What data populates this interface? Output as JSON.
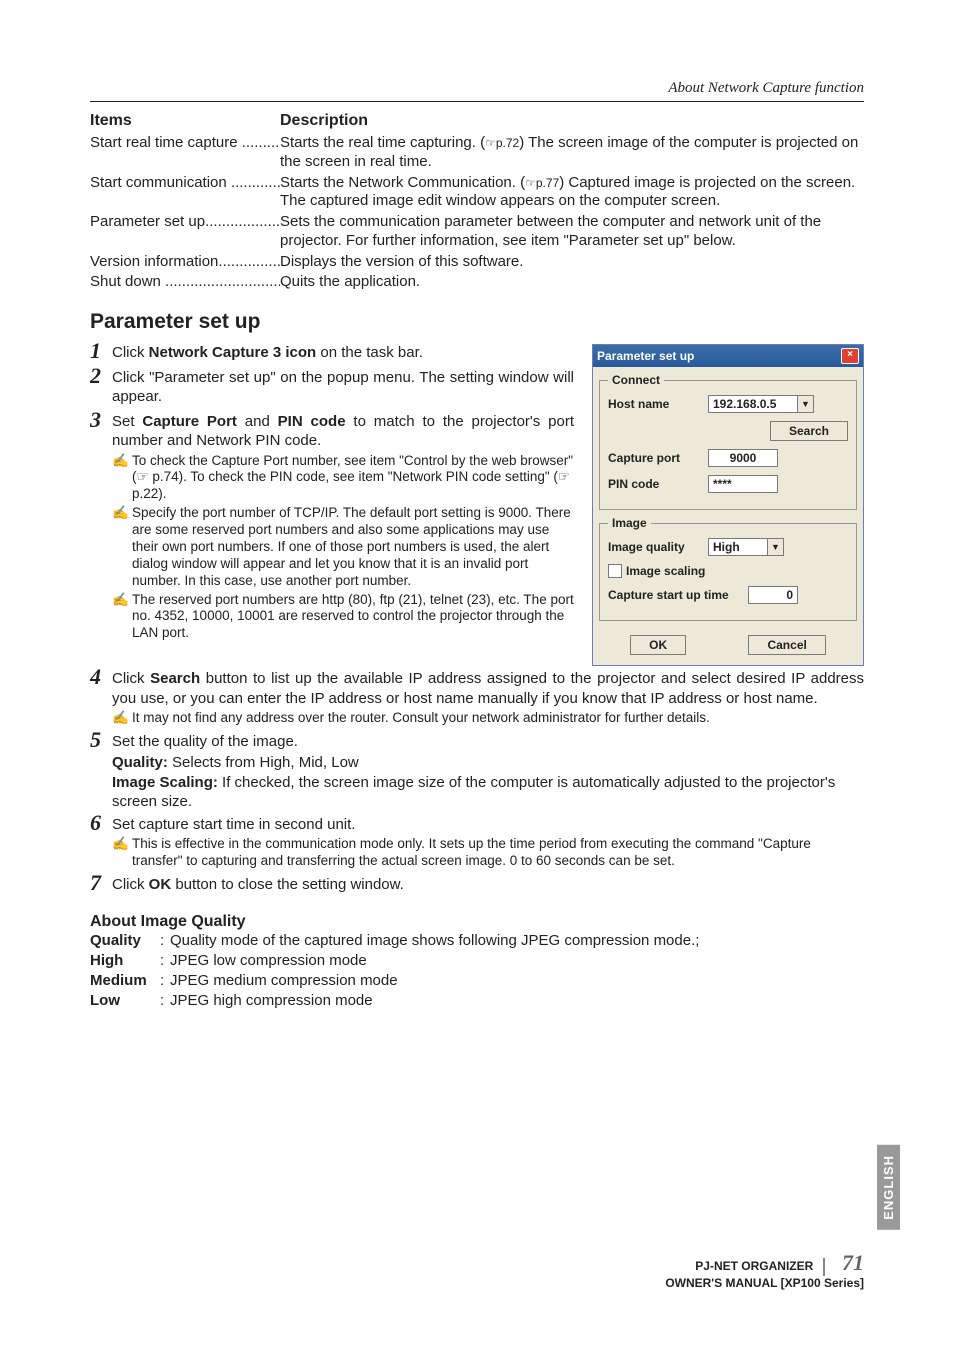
{
  "running_head": "About Network Capture function",
  "table": {
    "head_items": "Items",
    "head_desc": "Description",
    "rows": [
      {
        "item": "Start real time capture",
        "desc_pre": "Starts the real time capturing. (",
        "desc_ref": "☞p.72",
        "desc_post": ") The screen image of the computer is projected on the screen in real time."
      },
      {
        "item": "Start communication",
        "desc_pre": "Starts the Network Communication. (",
        "desc_ref": "☞p.77",
        "desc_post": ") Captured image is projected on the screen. The captured image edit window appears on the computer screen."
      },
      {
        "item": "Parameter set up",
        "desc_pre": "",
        "desc_ref": "",
        "desc_post": "Sets the communication parameter between the computer and network unit of the projector. For further information, see item \"Parameter set up\" below."
      },
      {
        "item": "Version information",
        "desc_pre": "",
        "desc_ref": "",
        "desc_post": "Displays the version of this software."
      },
      {
        "item": "Shut down",
        "desc_pre": "",
        "desc_ref": "",
        "desc_post": "Quits the application."
      }
    ]
  },
  "section_title": "Parameter set up",
  "steps": {
    "s1": {
      "num": "1",
      "pre": "Click ",
      "bold": "Network Capture 3 icon",
      "post": " on the task bar."
    },
    "s2": {
      "num": "2",
      "text": "Click \"Parameter set up\" on the popup menu. The setting window will appear."
    },
    "s3": {
      "num": "3",
      "pre": "Set ",
      "bold1": "Capture Port",
      "mid": " and ",
      "bold2": "PIN code",
      "post": " to match to the projector's port number and Network PIN code."
    },
    "s3n1": "To check the Capture Port number,  see item \"Control by the web browser\" (☞ p.74). To check the PIN code, see item \"Network PIN code setting\" (☞ p.22).",
    "s3n2": "Specify the port number of TCP/IP. The default port setting is 9000. There are some reserved port numbers and also some applications may use their own port numbers. If one of those port numbers is used, the alert dialog window will appear and let you know that it is an invalid port number. In this case, use another port number.",
    "s3n3": "The reserved port numbers are http (80), ftp (21), telnet (23), etc. The port no. 4352, 10000, 10001 are reserved to control the projector through the LAN port.",
    "s4": {
      "num": "4",
      "pre": "Click ",
      "bold": "Search",
      "post": " button to list up the available IP address assigned to the projector and select desired IP address you use, or you can enter the IP address or host name manually if you know that IP address or host name."
    },
    "s4n1": "It may not find any address over the router. Consult your network administrator for further details.",
    "s5": {
      "num": "5",
      "text": "Set the quality of the image."
    },
    "s5_qline": {
      "k": "Quality:",
      "v": " Selects from High, Mid, Low"
    },
    "s5_scline": {
      "k": "Image Scaling:",
      "v": " If checked, the screen image size of the computer is automatically adjusted to the projector's screen size."
    },
    "s6": {
      "num": "6",
      "text": "Set capture start time in second unit."
    },
    "s6n1": "This is effective in the communication mode only. It sets up the time period from executing the command \"Capture transfer\" to capturing and transferring the actual screen image. 0 to 60 seconds can be set.",
    "s7": {
      "num": "7",
      "pre": "Click ",
      "bold": "OK",
      "post": " button to close the setting window."
    }
  },
  "quality": {
    "heading": "About Image Quality",
    "rows": [
      {
        "k": "Quality",
        "v": "Quality mode of the captured image shows following JPEG compression mode.;"
      },
      {
        "k": "High",
        "v": "JPEG low compression mode"
      },
      {
        "k": "Medium",
        "v": "JPEG medium compression mode"
      },
      {
        "k": "Low",
        "v": "JPEG high compression mode"
      }
    ]
  },
  "dialog": {
    "title": "Parameter set up",
    "connect_legend": "Connect",
    "host_label": "Host name",
    "host_value": "192.168.0.5",
    "search_btn": "Search",
    "port_label": "Capture port",
    "port_value": "9000",
    "pin_label": "PIN code",
    "pin_value": "****",
    "image_legend": "Image",
    "quality_label": "Image quality",
    "quality_value": "High",
    "scaling_label": "Image scaling",
    "starttime_label": "Capture start up time",
    "starttime_value": "0",
    "ok": "OK",
    "cancel": "Cancel"
  },
  "side_tab": "ENGLISH",
  "footer": {
    "l1": "PJ-NET ORGANIZER",
    "l2": "OWNER'S MANUAL [XP100 Series]",
    "page": "71"
  }
}
